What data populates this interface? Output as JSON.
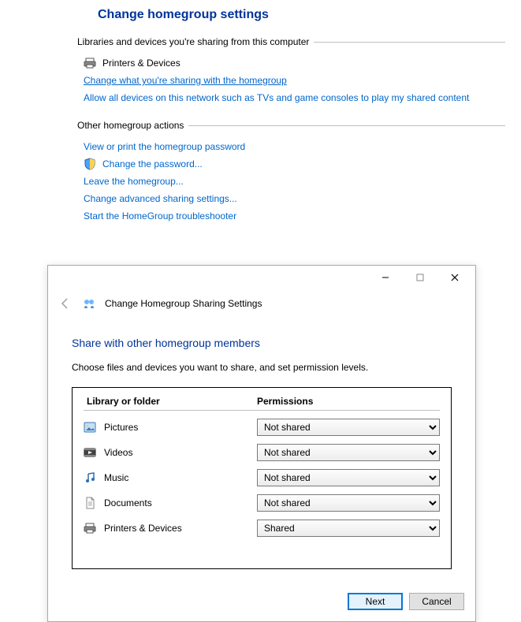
{
  "settings": {
    "title": "Change homegroup settings",
    "group1": {
      "legend": "Libraries and devices you're sharing from this computer",
      "printers_label": "Printers & Devices",
      "change_sharing": "Change what you're sharing with the homegroup",
      "allow_devices": "Allow all devices on this network such as TVs and game consoles to play my shared content"
    },
    "group2": {
      "legend": "Other homegroup actions",
      "view_password": "View or print the homegroup password",
      "change_password": "Change the password...",
      "leave": "Leave the homegroup...",
      "advanced": "Change advanced sharing settings...",
      "troubleshooter": "Start the HomeGroup troubleshooter"
    }
  },
  "dialog": {
    "window_title": "Change Homegroup Sharing Settings",
    "heading": "Share with other homegroup members",
    "instruction": "Choose files and devices you want to share, and set permission levels.",
    "col_library": "Library or folder",
    "col_permissions": "Permissions",
    "rows": {
      "pictures": {
        "label": "Pictures",
        "value": "Not shared"
      },
      "videos": {
        "label": "Videos",
        "value": "Not shared"
      },
      "music": {
        "label": "Music",
        "value": "Not shared"
      },
      "documents": {
        "label": "Documents",
        "value": "Not shared"
      },
      "printers": {
        "label": "Printers & Devices",
        "value": "Shared"
      }
    },
    "options": [
      "Shared",
      "Not shared"
    ],
    "next": "Next",
    "cancel": "Cancel"
  }
}
